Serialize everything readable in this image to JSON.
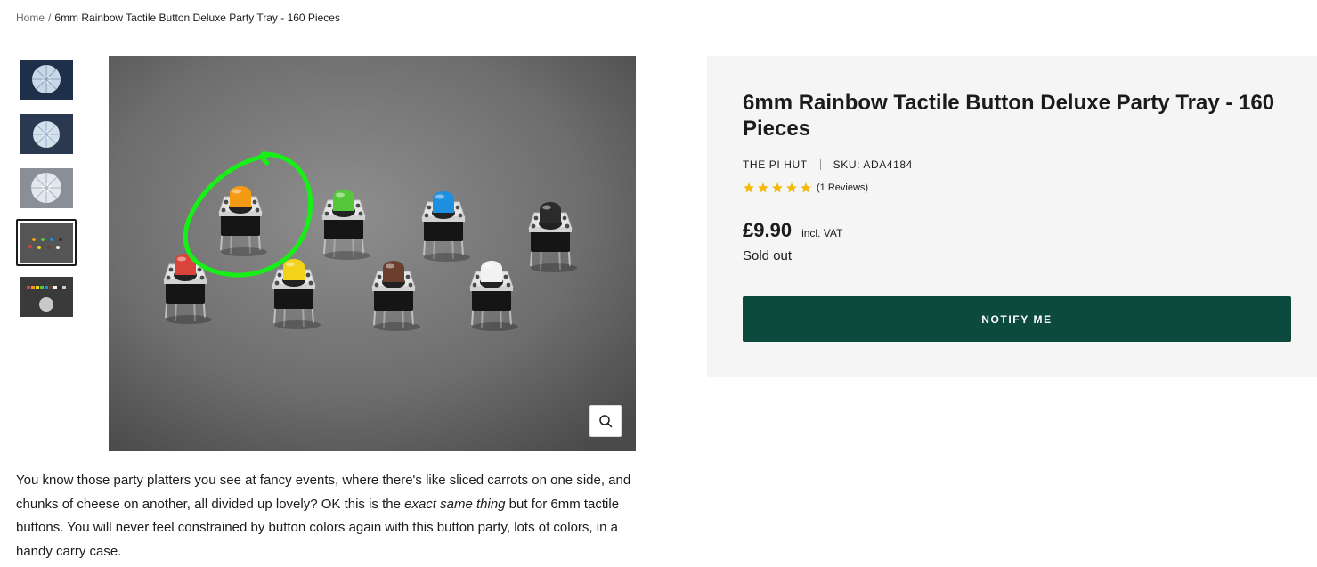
{
  "breadcrumb": {
    "home": "Home",
    "separator": "/",
    "current": "6mm Rainbow Tactile Button Deluxe Party Tray - 160 Pieces"
  },
  "gallery": {
    "thumbnail_count": 5,
    "active_thumbnail_index": 3,
    "zoom_icon": "magnifier-icon"
  },
  "product": {
    "title": "6mm Rainbow Tactile Button Deluxe Party Tray - 160 Pieces",
    "vendor": "THE PI HUT",
    "sku": "SKU: ADA4184",
    "rating_value": 5,
    "rating_max": 5,
    "reviews_text": "(1 Reviews)",
    "price": "£9.90",
    "tax_note": "incl. VAT",
    "stock_status": "Sold out",
    "notify_label": "NOTIFY ME"
  },
  "description": {
    "part1": "You know those party platters you see at fancy events, where there's like sliced carrots on one side, and chunks of cheese on another, all divided up lovely? OK this is the ",
    "emphasis": "exact same thing",
    "part2": " but for 6mm tactile buttons. You will never feel constrained by button colors again with this button party, lots of colors, in a handy carry case."
  },
  "colors": {
    "primary_button": "#0b4a3c",
    "panel_background": "#f5f5f5",
    "star": "#f5b700",
    "text": "#1c1b1b",
    "highlight_circle": "#17f017"
  },
  "image_buttons": [
    {
      "name": "orange",
      "color": "#f59b13"
    },
    {
      "name": "green",
      "color": "#54c83a"
    },
    {
      "name": "blue",
      "color": "#1f8fe0"
    },
    {
      "name": "black",
      "color": "#2b2b2b"
    },
    {
      "name": "red",
      "color": "#d9433a"
    },
    {
      "name": "yellow",
      "color": "#f3d21a"
    },
    {
      "name": "brown",
      "color": "#6b3e2e"
    },
    {
      "name": "white",
      "color": "#f2f2f2"
    }
  ]
}
